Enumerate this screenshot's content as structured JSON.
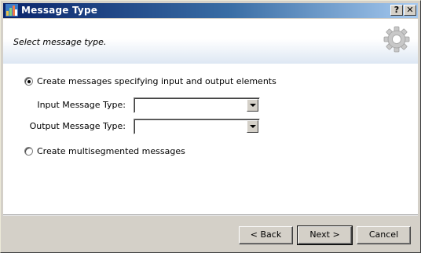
{
  "window": {
    "title": "Message Type",
    "help_label": "?",
    "close_label": "✕"
  },
  "header": {
    "instruction": "Select message type.",
    "icon": "gear-icon"
  },
  "options": {
    "specify_elements": {
      "label": "Create messages specifying input and output elements",
      "selected": true
    },
    "input_type": {
      "label": "Input Message Type:",
      "value": ""
    },
    "output_type": {
      "label": "Output Message Type:",
      "value": ""
    },
    "multisegmented": {
      "label": "Create multisegmented messages",
      "selected": false
    }
  },
  "buttons": {
    "back": "< Back",
    "next": "Next >",
    "cancel": "Cancel"
  }
}
